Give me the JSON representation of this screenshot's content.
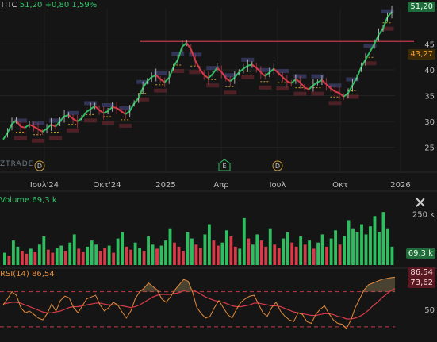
{
  "header": {
    "symbol": "TITC",
    "last": "51,20",
    "change": "+0,80",
    "change_pct": "1,59%"
  },
  "watermark": "ZTRADE",
  "price_tags": {
    "last_price": "51,20",
    "ma_value": "43,27",
    "volume_value": "69,3 k",
    "rsi_value": "86,54",
    "rsi_ma_value": "73,62"
  },
  "volume_panel": {
    "label": "Volume",
    "value": "69,3 k"
  },
  "rsi_panel": {
    "label": "RSI(14)",
    "value": "86,54"
  },
  "colors": {
    "up": "#2ebd5f",
    "down": "#d63b4a",
    "ma": "#c89a2a",
    "rsi": "#e58a3a",
    "rsi_ma": "#d63b4a"
  },
  "events": [
    {
      "icon": "dividend-icon",
      "letter": "D"
    },
    {
      "icon": "earnings-icon",
      "letter": "E"
    },
    {
      "icon": "dividend-icon",
      "letter": "D"
    }
  ],
  "chart_data": [
    {
      "type": "line",
      "title": "",
      "xlabel": "",
      "ylabel": "",
      "x_tick_labels": [
        "Ιουλ'24",
        "Οκτ'24",
        "2025",
        "Απρ",
        "Ιουλ",
        "Οκτ",
        "2026"
      ],
      "y_tick_labels": [
        "25",
        "30",
        "35",
        "40",
        "45"
      ],
      "ylim": [
        22,
        52
      ],
      "resistance_level": 45.5,
      "series": [
        {
          "values": [
            26.5,
            27.8,
            29.5,
            30.2,
            29.0,
            28.8,
            29.4,
            29.0,
            28.5,
            28.0,
            28.6,
            29.4,
            29.0,
            30.0,
            31.0,
            31.2,
            30.5,
            30.0,
            30.6,
            31.8,
            32.4,
            33.0,
            32.2,
            31.6,
            32.0,
            32.8,
            32.6,
            32.0,
            31.4,
            32.0,
            33.5,
            34.5,
            36.5,
            37.8,
            38.6,
            39.0,
            38.2,
            37.6,
            38.5,
            40.5,
            42.0,
            44.5,
            45.2,
            44.0,
            41.8,
            40.2,
            39.0,
            38.4,
            39.2,
            40.4,
            39.6,
            38.4,
            37.8,
            38.5,
            39.5,
            40.2,
            40.8,
            41.0,
            40.4,
            39.5,
            38.8,
            39.5,
            40.2,
            39.4,
            38.6,
            37.8,
            37.4,
            38.2,
            37.6,
            36.6,
            36.2,
            37.0,
            37.6,
            38.0,
            37.2,
            36.4,
            35.8,
            35.5,
            34.8,
            35.5,
            37.0,
            38.5,
            40.5,
            42.0,
            43.5,
            45.0,
            46.8,
            48.0,
            50.2,
            51.2
          ]
        }
      ]
    },
    {
      "type": "bar",
      "title": "Volume",
      "y_tick_labels": [
        "250 k"
      ],
      "values": [
        60,
        45,
        120,
        90,
        70,
        55,
        80,
        65,
        100,
        140,
        75,
        60,
        85,
        95,
        70,
        110,
        150,
        80,
        65,
        90,
        120,
        100,
        70,
        85,
        95,
        60,
        130,
        160,
        90,
        75,
        110,
        85,
        70,
        140,
        100,
        80,
        95,
        120,
        180,
        110,
        90,
        70,
        160,
        130,
        100,
        85,
        150,
        200,
        120,
        95,
        110,
        170,
        140,
        90,
        80,
        230,
        130,
        100,
        150,
        120,
        90,
        180,
        100,
        85,
        130,
        160,
        110,
        90,
        140,
        100,
        120,
        80,
        110,
        150,
        90,
        130,
        170,
        100,
        140,
        220,
        180,
        160,
        200,
        150,
        190,
        240,
        160,
        260,
        180,
        90
      ],
      "up": [
        1,
        0,
        1,
        1,
        0,
        0,
        1,
        0,
        1,
        1,
        0,
        0,
        1,
        1,
        0,
        1,
        1,
        0,
        0,
        1,
        1,
        1,
        0,
        0,
        1,
        0,
        1,
        1,
        0,
        0,
        1,
        1,
        0,
        1,
        1,
        0,
        1,
        1,
        1,
        0,
        0,
        0,
        1,
        1,
        0,
        0,
        1,
        1,
        0,
        0,
        1,
        1,
        0,
        0,
        1,
        1,
        0,
        1,
        1,
        0,
        0,
        1,
        0,
        0,
        1,
        1,
        0,
        0,
        1,
        0,
        1,
        0,
        1,
        1,
        0,
        1,
        1,
        0,
        1,
        1,
        1,
        1,
        1,
        1,
        1,
        1,
        1,
        1,
        1,
        1
      ]
    },
    {
      "type": "line",
      "title": "RSI(14)",
      "y_tick_labels": [
        "50"
      ],
      "ylim": [
        20,
        95
      ],
      "series": [
        {
          "values": [
            55,
            62,
            70,
            66,
            52,
            46,
            48,
            44,
            40,
            38,
            45,
            56,
            48,
            60,
            65,
            63,
            52,
            46,
            54,
            62,
            64,
            66,
            55,
            48,
            52,
            58,
            55,
            47,
            40,
            48,
            62,
            70,
            74,
            80,
            76,
            72,
            62,
            58,
            64,
            72,
            78,
            84,
            82,
            70,
            52,
            45,
            40,
            42,
            52,
            60,
            52,
            44,
            40,
            50,
            58,
            62,
            65,
            66,
            56,
            46,
            42,
            52,
            58,
            48,
            42,
            38,
            36,
            46,
            44,
            36,
            34,
            44,
            50,
            54,
            45,
            38,
            34,
            33,
            28,
            38,
            52,
            62,
            72,
            78,
            80,
            82,
            84,
            85,
            86,
            86.54
          ]
        },
        {
          "values": [
            56,
            57,
            58,
            58,
            57,
            55,
            53,
            51,
            49,
            47,
            46,
            46,
            47,
            48,
            50,
            52,
            53,
            53,
            54,
            55,
            56,
            57,
            57,
            56,
            55,
            55,
            55,
            54,
            53,
            52,
            53,
            55,
            58,
            61,
            64,
            66,
            67,
            67,
            67,
            68,
            69,
            71,
            72,
            72,
            70,
            67,
            64,
            62,
            60,
            59,
            58,
            56,
            54,
            53,
            53,
            54,
            55,
            57,
            57,
            56,
            55,
            54,
            54,
            53,
            51,
            49,
            47,
            46,
            45,
            44,
            43,
            43,
            44,
            45,
            45,
            44,
            42,
            41,
            39,
            39,
            40,
            42,
            45,
            49,
            54,
            58,
            63,
            67,
            71,
            73.62
          ]
        }
      ]
    }
  ]
}
